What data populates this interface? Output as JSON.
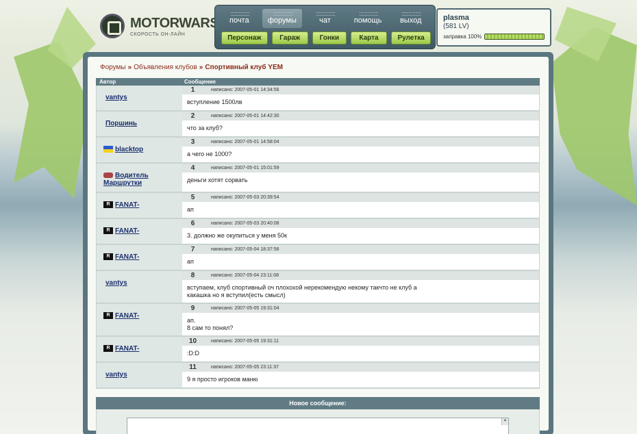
{
  "logo": {
    "name": "MOTORWARS.RU",
    "tagline": "СКОРОСТЬ ОН-ЛАЙН"
  },
  "topnav": {
    "items": [
      {
        "label": "почта",
        "active": false
      },
      {
        "label": "форумы",
        "active": true
      },
      {
        "label": "чат",
        "active": false
      },
      {
        "label": "помощь",
        "active": false
      },
      {
        "label": "выход",
        "active": false
      }
    ],
    "buttons": [
      {
        "label": "Персонаж"
      },
      {
        "label": "Гараж"
      },
      {
        "label": "Гонки"
      },
      {
        "label": "Карта"
      },
      {
        "label": "Рулетка"
      }
    ]
  },
  "user": {
    "name": "plasma",
    "level": "(581 LV)",
    "fuel_label": "заправка 100%",
    "fuel_percent": 100
  },
  "breadcrumb": {
    "items": [
      "Форумы",
      "Объявления клубов",
      "Спортивный клуб YEM"
    ],
    "separator": "»"
  },
  "table": {
    "col_author": "Автор",
    "col_message": "Сообщение"
  },
  "posts": [
    {
      "num": "1",
      "author": "vantys",
      "badge": "none",
      "date": "написано: 2007-05-01 14:34:56",
      "lines": [
        "вступление 1500лв"
      ]
    },
    {
      "num": "2",
      "author": "Поршинь",
      "badge": "none",
      "date": "написано: 2007-05-01 14:42:30",
      "lines": [
        "что за клуб?"
      ]
    },
    {
      "num": "3",
      "author": "blacktop",
      "badge": "flag",
      "date": "написано: 2007-05-01 14:58:04",
      "lines": [
        "а чего не 1000?"
      ]
    },
    {
      "num": "4",
      "author": "Водитель Маршрутки",
      "badge": "minibus",
      "date": "написано: 2007-05-01 15:01:59",
      "lines": [
        "деньги хотят сорвать"
      ]
    },
    {
      "num": "5",
      "author": "FANAT-",
      "badge": "R",
      "date": "написано: 2007-05-03 20:39:54",
      "lines": [
        "ап"
      ]
    },
    {
      "num": "6",
      "author": "FANAT-",
      "badge": "R",
      "date": "написано: 2007-05-03 20:40:08",
      "lines": [
        "3. должно же окупиться у меня 50к"
      ]
    },
    {
      "num": "7",
      "author": "FANAT-",
      "badge": "R",
      "date": "написано: 2007-05-04 18:37:56",
      "lines": [
        "ап"
      ]
    },
    {
      "num": "8",
      "author": "vantys",
      "badge": "none",
      "date": "написано: 2007-05-04 23:11:08",
      "lines": [
        "вступаем, клуб спортивный оч плохохой нерекомендую некому такчто не клуб а",
        "какашка но я вступил(есть смысл)"
      ]
    },
    {
      "num": "9",
      "author": "FANAT-",
      "badge": "R",
      "date": "написано: 2007-05-05 19:31:04",
      "lines": [
        "ап.",
        "8 сам то понял?"
      ]
    },
    {
      "num": "10",
      "author": "FANAT-",
      "badge": "R",
      "date": "написано: 2007-05-05 19:31:11",
      "lines": [
        ":D:D"
      ]
    },
    {
      "num": "11",
      "author": "vantys",
      "badge": "none",
      "date": "написано: 2007-05-05 23:11:37",
      "lines": [
        "9 я просто игроков маню"
      ]
    }
  ],
  "new_message": {
    "title": "Новое сообщение:"
  }
}
